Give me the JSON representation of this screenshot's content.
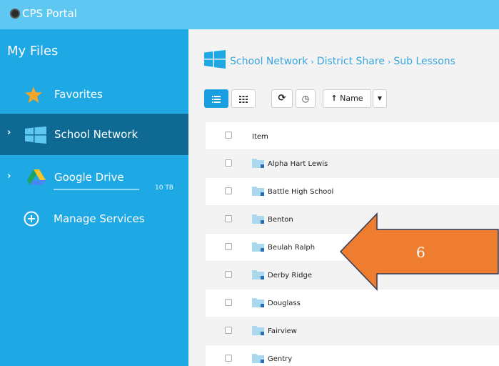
{
  "app": {
    "title": "CPS Portal"
  },
  "sidebar": {
    "heading": "My Files",
    "items": [
      {
        "label": "Favorites",
        "icon": "star-icon"
      },
      {
        "label": "School Network",
        "icon": "windows-icon",
        "active": true
      },
      {
        "label": "Google Drive",
        "icon": "google-drive-icon",
        "size": "10 TB"
      },
      {
        "label": "Manage Services",
        "icon": "plus-circle-icon"
      }
    ]
  },
  "breadcrumb": {
    "icon": "windows-icon",
    "parts": [
      "School Network",
      "District Share",
      "Sub Lessons"
    ]
  },
  "toolbar": {
    "sort_label": "Name"
  },
  "list": {
    "header": "Item",
    "rows": [
      "Alpha Hart Lewis",
      "Battle High School",
      "Benton",
      "Beulah Ralph",
      "Derby Ridge",
      "Douglass",
      "Fairview",
      "Gentry"
    ]
  },
  "annotation": {
    "number": "6",
    "color": "#ee7d2f"
  },
  "colors": {
    "topbar": "#5fc8f2",
    "sidebar": "#1ea8e4",
    "sidebar_active": "#0f6a93",
    "accent": "#3aa6dd"
  }
}
